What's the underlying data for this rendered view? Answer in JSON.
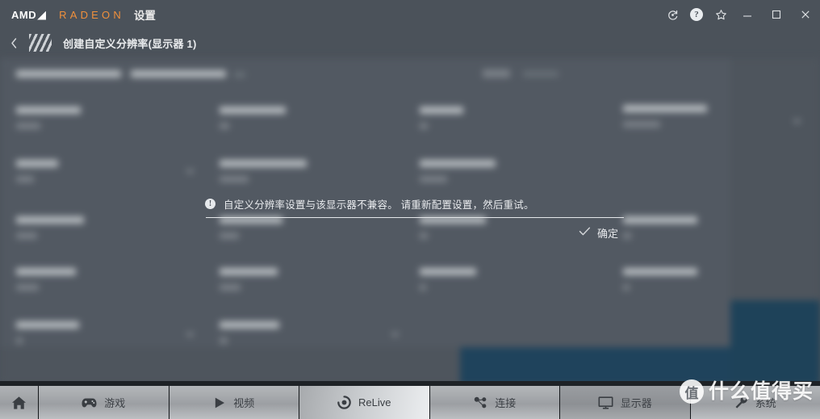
{
  "titlebar": {
    "brand": "AMD",
    "product": "RADEON",
    "section": "设置",
    "icons": [
      {
        "name": "update-icon",
        "glyph": "update"
      },
      {
        "name": "help-icon",
        "glyph": "?"
      },
      {
        "name": "favorite-star-icon",
        "glyph": "star"
      },
      {
        "name": "minimize-button",
        "glyph": "minimize"
      },
      {
        "name": "maximize-button",
        "glyph": "maximize"
      },
      {
        "name": "close-button",
        "glyph": "close"
      }
    ]
  },
  "header": {
    "back_label": "返回",
    "title": "创建自定义分辨率(显示器 1)"
  },
  "dialog": {
    "icon": "warning-icon",
    "icon_glyph": "!",
    "message": "自定义分辨率设置与该显示器不兼容。 请重新配置设置，然后重试。",
    "confirm_label": "确定"
  },
  "bottom_nav": {
    "home_label": "主页",
    "tabs": [
      {
        "label": "游戏",
        "icon": "gamepad-icon",
        "state": "normal"
      },
      {
        "label": "视频",
        "icon": "play-icon",
        "state": "normal"
      },
      {
        "label": "ReLive",
        "icon": "record-icon",
        "state": "highlight"
      },
      {
        "label": "连接",
        "icon": "share-nodes-icon",
        "state": "normal"
      },
      {
        "label": "显示器",
        "icon": "monitor-icon",
        "state": "active"
      },
      {
        "label": "系统",
        "icon": "wrench-icon",
        "state": "normal"
      }
    ]
  },
  "watermark": {
    "badge": "值",
    "text": "什么值得买"
  },
  "colors": {
    "titlebar_bg": "#4b525a",
    "panel_bg": "#525962",
    "accent_orange": "#f0903c",
    "blue_region": "#1f435c",
    "nav_divider": "#14171a"
  }
}
